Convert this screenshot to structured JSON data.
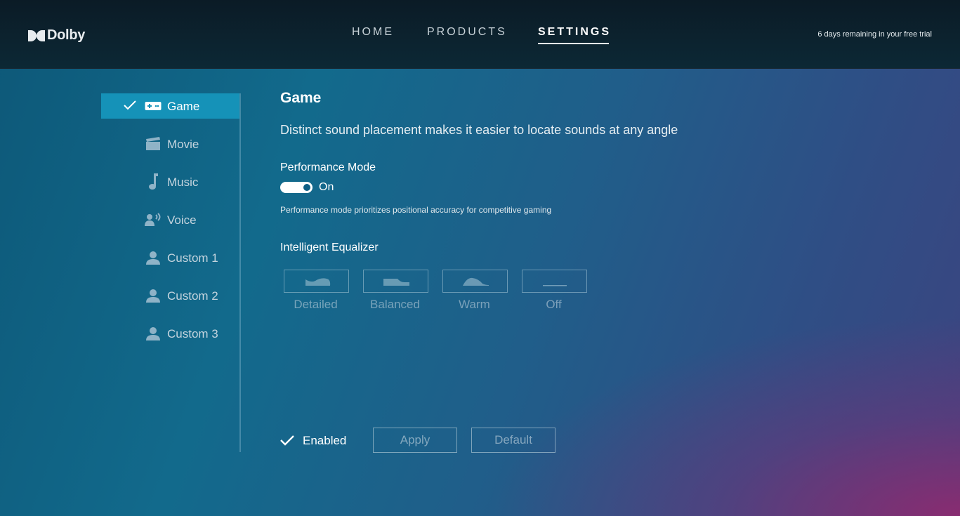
{
  "app": {
    "brand": "Dolby"
  },
  "nav": {
    "home": "HOME",
    "products": "PRODUCTS",
    "settings": "SETTINGS",
    "active": "SETTINGS"
  },
  "trial_notice": "6 days remaining in your free trial",
  "sidebar": {
    "items": [
      {
        "label": "Game",
        "icon": "gamepad-icon",
        "selected": true
      },
      {
        "label": "Movie",
        "icon": "clapperboard-icon",
        "selected": false
      },
      {
        "label": "Music",
        "icon": "music-note-icon",
        "selected": false
      },
      {
        "label": "Voice",
        "icon": "voice-icon",
        "selected": false
      },
      {
        "label": "Custom 1",
        "icon": "person-icon",
        "selected": false
      },
      {
        "label": "Custom 2",
        "icon": "person-icon",
        "selected": false
      },
      {
        "label": "Custom 3",
        "icon": "person-icon",
        "selected": false
      }
    ]
  },
  "main": {
    "title": "Game",
    "description": "Distinct sound placement makes it easier to locate sounds at any angle",
    "performance": {
      "title": "Performance Mode",
      "state": "On",
      "enabled": true,
      "note": "Performance mode prioritizes positional accuracy for competitive gaming"
    },
    "equalizer": {
      "title": "Intelligent Equalizer",
      "options": [
        {
          "label": "Detailed",
          "icon": "eq-detailed-icon"
        },
        {
          "label": "Balanced",
          "icon": "eq-balanced-icon"
        },
        {
          "label": "Warm",
          "icon": "eq-warm-icon"
        },
        {
          "label": "Off",
          "icon": "eq-off-icon"
        }
      ]
    }
  },
  "footer": {
    "enabled_label": "Enabled",
    "enabled": true,
    "apply_label": "Apply",
    "default_label": "Default"
  },
  "colors": {
    "accent": "#1592b8",
    "topbar": "#0b1b26",
    "background": "#126a8c",
    "glow": "#962870"
  }
}
